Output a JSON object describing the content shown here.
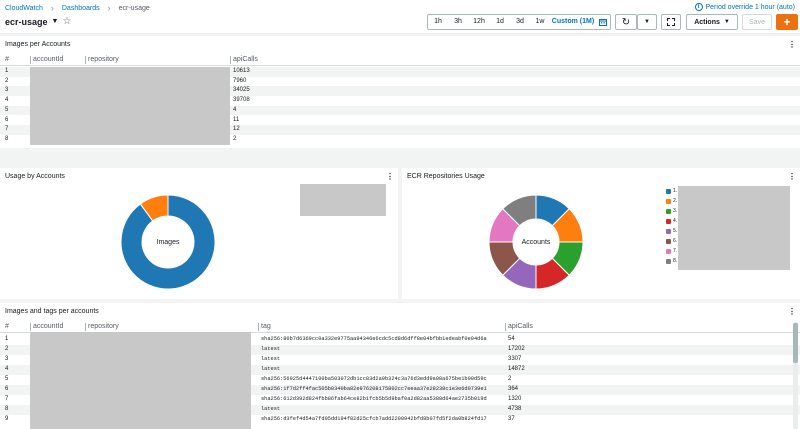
{
  "breadcrumbs": [
    "CloudWatch",
    "Dashboards",
    "ecr-usage"
  ],
  "dashboard_title": "ecr-usage",
  "period_override": "Period override 1 hour (auto)",
  "time_ranges": [
    "1h",
    "3h",
    "12h",
    "1d",
    "3d",
    "1w",
    "Custom (1M)"
  ],
  "active_range": "Custom (1M)",
  "actions_label": "Actions",
  "save_label": "Save",
  "add_label": "+",
  "panel1": {
    "title": "Images per Accounts",
    "columns": [
      "#",
      "accountId",
      "repository",
      "apiCalls"
    ],
    "rows": [
      {
        "n": "1",
        "api": "10613"
      },
      {
        "n": "2",
        "api": "7960"
      },
      {
        "n": "3",
        "api": "34025"
      },
      {
        "n": "4",
        "api": "39708"
      },
      {
        "n": "5",
        "api": "4"
      },
      {
        "n": "6",
        "api": "11"
      },
      {
        "n": "7",
        "api": "12"
      },
      {
        "n": "8",
        "api": "2"
      }
    ]
  },
  "panel2": {
    "title": "Usage by Accounts",
    "center_label": "Images"
  },
  "panel3": {
    "title": "ECR Repositories Usage",
    "center_label": "Accounts",
    "legend": [
      "1.",
      "2.",
      "3.",
      "4.",
      "5.",
      "6.",
      "7.",
      "8."
    ]
  },
  "panel4": {
    "title": "Images and tags per accounts",
    "columns": [
      "#",
      "accountId",
      "repository",
      "tag",
      "apiCalls"
    ],
    "rows": [
      {
        "n": "1",
        "tag": "sha256:80b7d6369cc0a332e9775aa94346e6cdc5cd8d6dff8e04bfbb1edeabf0e04d6a",
        "api": "54"
      },
      {
        "n": "2",
        "tag": "latest",
        "api": "17202"
      },
      {
        "n": "3",
        "tag": "latest",
        "api": "3307"
      },
      {
        "n": "4",
        "tag": "latest",
        "api": "14872"
      },
      {
        "n": "5",
        "tag": "sha256:56925d4447100ba503072db1cc83d2a9b324c3a76d3edd9a08a675be1b00d59c",
        "api": "2"
      },
      {
        "n": "6",
        "tag": "sha256:1f7d2ff4fac505b0340ba82e976208175802cc7eeaa37e28238c1e3e6d0739e1",
        "api": "364"
      },
      {
        "n": "7",
        "tag": "sha256:612d392d824fbb86fab64ce82b1fcb5b5d9baf0a2d82aa5388d64ae2735b019d",
        "api": "1320"
      },
      {
        "n": "8",
        "tag": "latest",
        "api": "4738"
      },
      {
        "n": "9",
        "tag": "sha256:d3fef4d54a7fd05dd194f82d25cfcb7add2200942bfd8b07fd5f2da0b824fd17",
        "api": "37"
      }
    ]
  },
  "chart_data": [
    {
      "type": "pie",
      "title": "Usage by Accounts",
      "values": [
        90,
        10
      ],
      "colors": [
        "#1f77b4",
        "#ff7f0e"
      ]
    },
    {
      "type": "pie",
      "title": "ECR Repositories Usage",
      "values": [
        12.5,
        12.5,
        12.5,
        12.5,
        12.5,
        12.5,
        12.5,
        12.5
      ],
      "colors": [
        "#1f77b4",
        "#ff7f0e",
        "#2ca02c",
        "#d62728",
        "#9467bd",
        "#8c564b",
        "#e377c2",
        "#7f7f7f"
      ]
    }
  ]
}
